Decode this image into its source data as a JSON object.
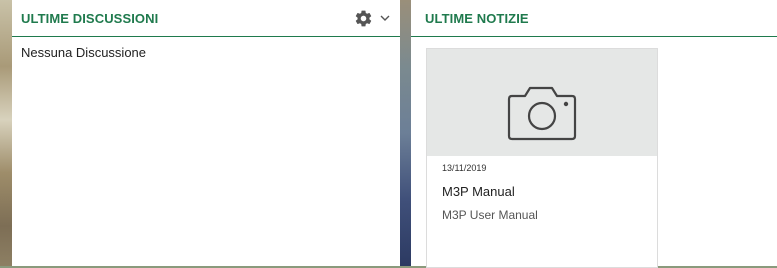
{
  "left_panel": {
    "title": "ULTIME DISCUSSIONI",
    "empty_message": "Nessuna Discussione",
    "tools": {
      "settings_icon": "gear-icon",
      "menu_icon": "chevron-down-icon"
    }
  },
  "right_panel": {
    "title": "ULTIME NOTIZIE",
    "news": [
      {
        "date": "13/11/2019",
        "title": "M3P Manual",
        "subtitle": "M3P User Manual",
        "image_icon": "camera-icon"
      }
    ]
  },
  "colors": {
    "accent": "#1f7a4d",
    "card_image_bg": "#e5e7e6",
    "text": "#222222"
  }
}
